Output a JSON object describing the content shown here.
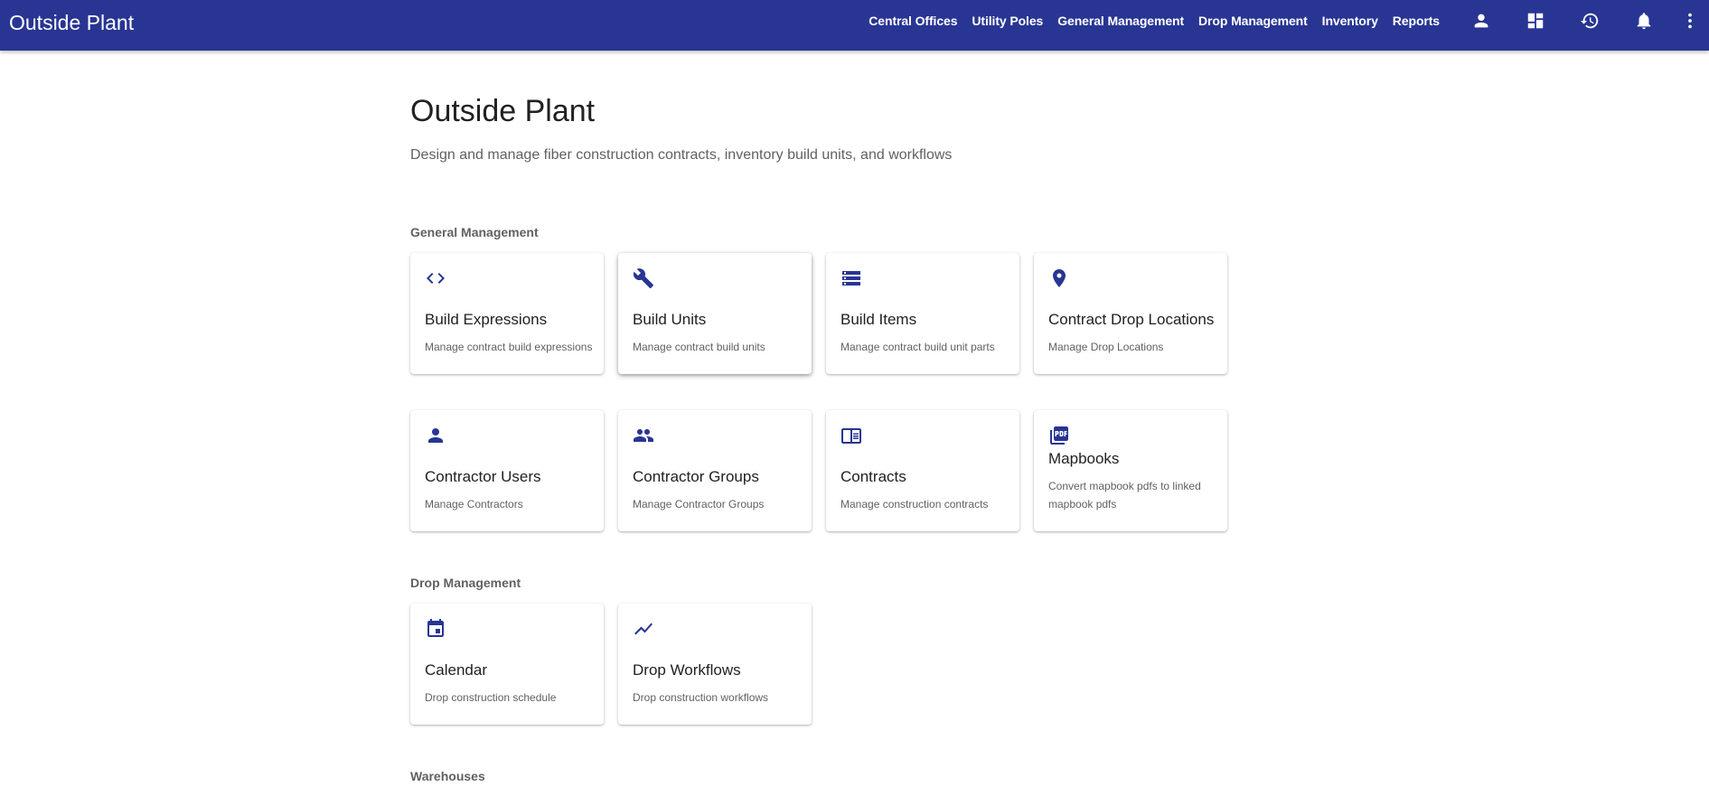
{
  "app": {
    "title": "Outside Plant"
  },
  "nav": {
    "links": [
      "Central Offices",
      "Utility Poles",
      "General Management",
      "Drop Management",
      "Inventory",
      "Reports"
    ]
  },
  "page": {
    "title": "Outside Plant",
    "subtitle": "Design and manage fiber construction contracts, inventory build units, and workflows"
  },
  "sections": {
    "general": {
      "title": "General Management",
      "cards": [
        {
          "title": "Build Expressions",
          "desc": "Manage contract build expressions",
          "icon": "code-icon"
        },
        {
          "title": "Build Units",
          "desc": "Manage contract build units",
          "icon": "wrench-icon"
        },
        {
          "title": "Build Items",
          "desc": "Manage contract build unit parts",
          "icon": "storage-icon"
        },
        {
          "title": "Contract Drop Locations",
          "desc": "Manage Drop Locations",
          "icon": "location-pin-icon"
        },
        {
          "title": "Contractor Users",
          "desc": "Manage Contractors",
          "icon": "person-icon"
        },
        {
          "title": "Contractor Groups",
          "desc": "Manage Contractor Groups",
          "icon": "people-icon"
        },
        {
          "title": "Contracts",
          "desc": "Manage construction contracts",
          "icon": "book-icon"
        },
        {
          "title": "Mapbooks",
          "desc": "Convert mapbook pdfs to linked mapbook pdfs",
          "icon": "pdf-icon"
        }
      ]
    },
    "drop": {
      "title": "Drop Management",
      "cards": [
        {
          "title": "Calendar",
          "desc": "Drop construction schedule",
          "icon": "calendar-icon"
        },
        {
          "title": "Drop Workflows",
          "desc": "Drop construction workflows",
          "icon": "trending-icon"
        }
      ]
    },
    "warehouses": {
      "title": "Warehouses"
    }
  },
  "colors": {
    "primary": "#283593",
    "text": "#212121",
    "muted": "#616161"
  }
}
